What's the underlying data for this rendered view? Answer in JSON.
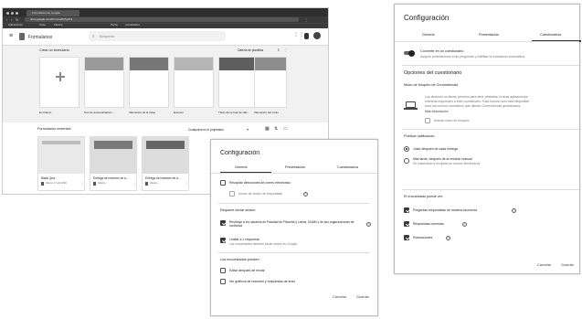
{
  "browser": {
    "tab_title": "Formularios de Google",
    "url": "docs.google.com/forms/u/0/?tgif=d",
    "bookmarks": [
      "Aplicaciones",
      "Otras",
      "Fábrica",
      "Pecho",
      "Actualidades"
    ]
  },
  "forms_app": {
    "app_title": "Formularios",
    "search_placeholder": "Búsqueda",
    "new_form_heading": "Crear un formulario",
    "gallery_label": "Galería de plantillas",
    "templates": [
      "En blanco",
      "Test de autoevaluación ...",
      "Valoración de la clase",
      "Examen",
      "Título de la hoja de cálc...",
      "Valoración del curso"
    ],
    "recent_heading": "Formularios recientes",
    "owner_filter": "Cualquiera es el propietario",
    "recent": [
      {
        "title": "Blank Quiz",
        "meta": "Abierto 17 abr 2020"
      },
      {
        "title": "Entrega de informes de a...",
        "meta": "Abierto..."
      },
      {
        "title": "Entrega de informes de a...",
        "meta": "Abierto..."
      }
    ]
  },
  "dialog_left": {
    "title": "Configuración",
    "tabs": [
      "General",
      "Presentación",
      "Cuestionarios"
    ],
    "collect_emails": "Recopilar direcciones de correo electrónico",
    "receipt": "Acuse de recibo de respuestas",
    "requires_heading": "Requiere iniciar sesión:",
    "restrict_users": "Restringir a los usuarios de Facultad de Filosofía y Letras, UNAM y de sus organizaciones de confianza",
    "limit_one": "Limitar a 1 respuesta",
    "limit_one_desc": "Los encuestados deberán iniciar sesión en Google",
    "respondents_heading": "Los encuestados pueden:",
    "edit_after": "Editar después de enviar",
    "see_summary": "Ver gráficos de resumen y respuestas de texto",
    "cancel": "Cancelar",
    "save": "Guardar"
  },
  "dialog_right": {
    "title": "Configuración",
    "tabs": [
      "General",
      "Presentación",
      "Cuestionarios"
    ],
    "make_quiz": "Convertir en un cuestionario",
    "make_quiz_desc": "Asignar puntuaciones a las preguntas y habilitar la evaluación automática.",
    "options_heading": "Opciones del cuestionario",
    "lock_heading": "Modo de bloqueo de Chromebooks",
    "lock_desc_1": "Los alumnos no tienen permiso para abrir pestañas ni otras aplicaciones",
    "lock_desc_2": "mientras responden a este cuestionario. Esta función solo está disponible",
    "lock_desc_3": "para los correos educativos que utilicen Chromebooks gestionados.",
    "lock_link": "Más información",
    "lock_toggle": "Activar modo de bloqueo",
    "publish_heading": "Publicar calificación:",
    "immediately": "Justo después de cada entrega",
    "later": "Más tarde, después de la revisión manual",
    "later_desc": "Se empezarán a recopilar los correos electrónicos",
    "respondent_heading": "El encuestado puede ver:",
    "missed": "Preguntas respondidas de manera incorrecta",
    "correct": "Respuestas correctas",
    "values": "Puntuaciones",
    "cancel": "Cancelar",
    "save": "Guardar"
  }
}
